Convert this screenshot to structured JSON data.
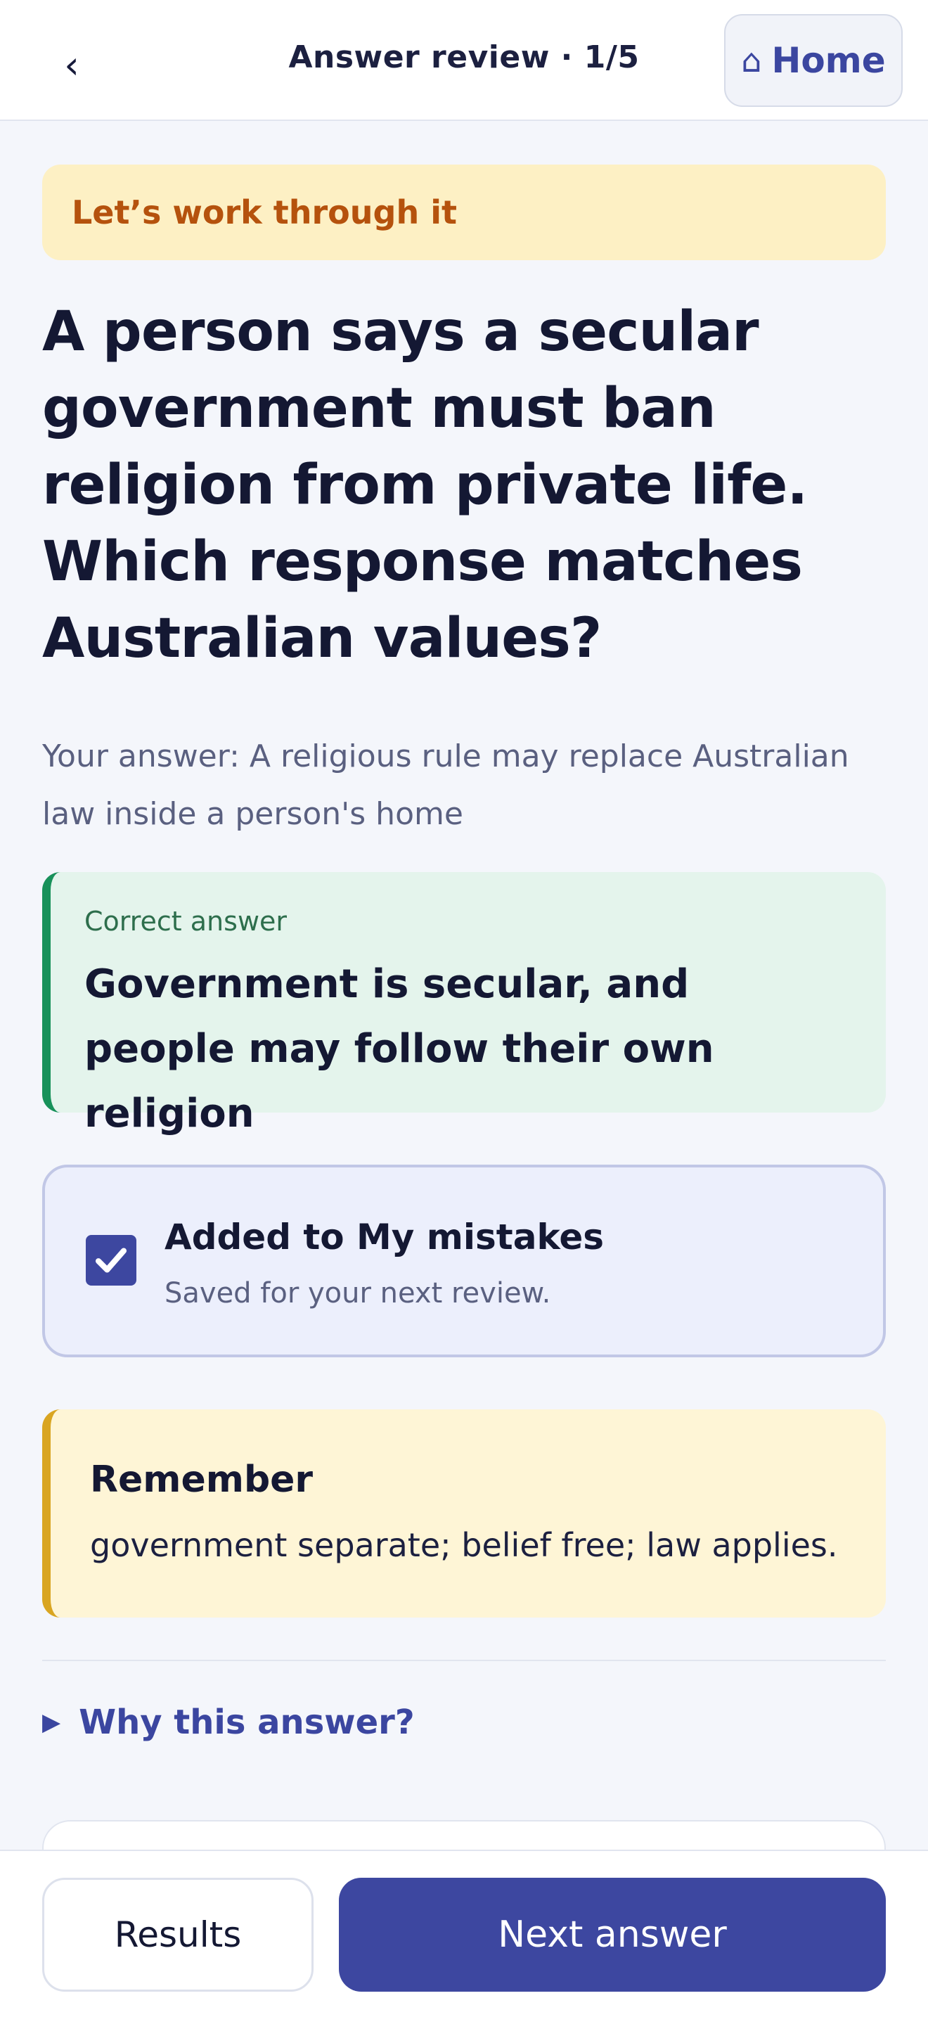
{
  "header": {
    "back_icon": "chevron-left-icon",
    "back_glyph": "‹",
    "title": "Answer review · 1/5",
    "home_icon": "home-icon",
    "home_glyph": "⌂",
    "home_label": "Home"
  },
  "banner": {
    "text": "Let’s work through it"
  },
  "question": {
    "text": "A person says a secular government must ban religion from private life. Which response matches Australian values?"
  },
  "your_answer": {
    "text": "Your answer: A religious rule may replace Australian law inside a person's home"
  },
  "correct_answer": {
    "label": "Correct answer",
    "text": "Government is secular, and people may follow their own religion"
  },
  "mistakes": {
    "checked": true,
    "title": "Added to My mistakes",
    "subtitle": "Saved for your next review."
  },
  "remember": {
    "title": "Remember",
    "text": "government separate; belief free; law applies."
  },
  "why": {
    "icon": "triangle-right-icon",
    "glyph": "▶",
    "label": "Why this answer?"
  },
  "footer": {
    "results_label": "Results",
    "next_label": "Next answer"
  },
  "colors": {
    "accent": "#3d47a0",
    "banner_bg": "#fdf0c4",
    "banner_text": "#b5520d",
    "correct_bg": "#e4f4ec",
    "correct_border": "#18915a",
    "remember_bg": "#fef5d6",
    "remember_border": "#d9a521"
  }
}
